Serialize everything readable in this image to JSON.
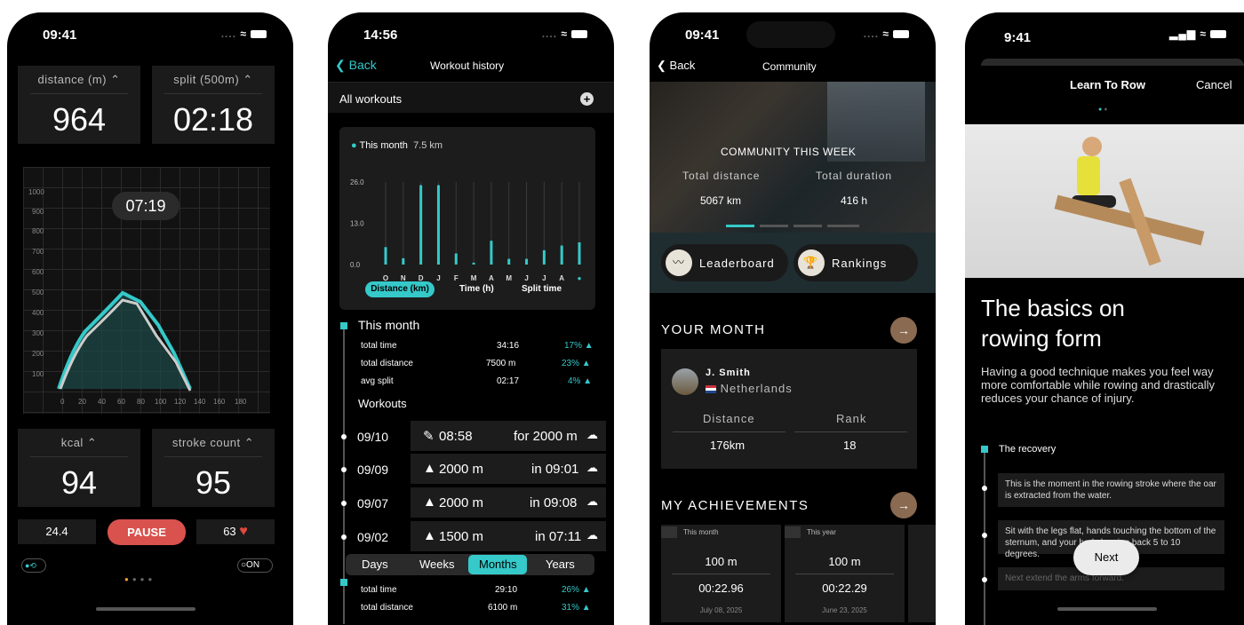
{
  "phone1": {
    "status_time": "09:41",
    "status_icons": "....",
    "tiles": [
      {
        "label": "distance (m) ⌃",
        "value": "964"
      },
      {
        "label": "split (500m) ⌃",
        "value": "02:18"
      },
      {
        "label": "kcal ⌃",
        "value": "94"
      },
      {
        "label": "stroke count ⌃",
        "value": "95"
      }
    ],
    "timer": "07:19",
    "y_ticks": [
      "1000",
      "900",
      "800",
      "700",
      "600",
      "500",
      "400",
      "300",
      "200",
      "100"
    ],
    "x_ticks": [
      "0",
      "20",
      "40",
      "60",
      "80",
      "100",
      "120",
      "140",
      "160",
      "180"
    ],
    "left_metric": "24.4",
    "pause_label": "PAUSE",
    "heart_value": "63",
    "toggle_label": "ON",
    "accent": "#35c9c9",
    "pause_color": "#d9524d",
    "heart_color": "#e0483f",
    "progress_fraction": 0.5
  },
  "phone2": {
    "status_time": "14:56",
    "status_icons": "....",
    "back_label": "Back",
    "title": "Workout history",
    "all_workouts": "All workouts",
    "legend": "This month",
    "legend_value": "7.5 km",
    "chart_data": {
      "type": "bar",
      "categories": [
        "O",
        "N",
        "D",
        "J",
        "F",
        "M",
        "A",
        "M",
        "J",
        "J",
        "A",
        "●"
      ],
      "series": [
        {
          "name": "",
          "values": [
            5.5,
            2,
            25,
            25,
            3.5,
            0.6,
            7.5,
            1.8,
            1.8,
            4.5,
            6,
            7
          ]
        }
      ],
      "y_ticks": [
        "26.0",
        "13.0",
        "0.0"
      ],
      "ylim": [
        0,
        26
      ],
      "grid": true
    },
    "metric_tabs": [
      "Distance (km)",
      "Time (h)",
      "Split time"
    ],
    "this_month": "This month",
    "stats": [
      {
        "label": "total time",
        "value": "34:16",
        "pct": "17%"
      },
      {
        "label": "total distance",
        "value": "7500 m",
        "pct": "23%"
      },
      {
        "label": "avg split",
        "value": "02:17",
        "pct": "4%"
      }
    ],
    "workouts_label": "Workouts",
    "workouts": [
      {
        "date": "09/10",
        "dist": "08:58",
        "result": "for 2000 m"
      },
      {
        "date": "09/09",
        "dist": "2000 m",
        "result": "in 09:01"
      },
      {
        "date": "09/07",
        "dist": "2000 m",
        "result": "in 09:08"
      },
      {
        "date": "09/02",
        "dist": "1500 m",
        "result": "in 07:11"
      }
    ],
    "period_tabs": [
      "Days",
      "Weeks",
      "Months",
      "Years"
    ],
    "bottom_stats": [
      {
        "label": "total time",
        "value": "29:10",
        "pct": "26%"
      },
      {
        "label": "total distance",
        "value": "6100 m",
        "pct": "31%"
      }
    ]
  },
  "phone3": {
    "status_time": "09:41",
    "status_icons": "....",
    "back_label": "Back",
    "title": "Community",
    "hero_title": "COMMUNITY THIS WEEK",
    "hero_labels": [
      "Total distance",
      "Total duration"
    ],
    "hero_values": [
      "5067 km",
      "416 h"
    ],
    "leaderboard": "Leaderboard",
    "rankings": "Rankings",
    "your_month": "YOUR MONTH",
    "user_name": "J. Smith",
    "user_country": "Netherlands",
    "col_labels": [
      "Distance",
      "Rank"
    ],
    "col_values": [
      "176km",
      "18"
    ],
    "achievements": "MY ACHIEVEMENTS",
    "ach_cards": [
      {
        "tag": "This month",
        "dist": "100 m",
        "time": "00:22.96",
        "date": "July 08, 2025"
      },
      {
        "tag": "This year",
        "dist": "100 m",
        "time": "00:22.29",
        "date": "June 23, 2025"
      }
    ]
  },
  "phone4": {
    "status_time": "9:41",
    "title": "Learn To Row",
    "cancel": "Cancel",
    "heading_line1": "The basics on",
    "heading_line2": "rowing form",
    "body": "Having a good technique makes you feel way more comfortable while rowing and drastically reduces your chance of injury.",
    "section": "The recovery",
    "steps": [
      "This is the moment in the rowing stroke where the oar is extracted from the water.",
      "Sit with the legs flat, hands touching the bottom of the sternum, and your body leaning back 5 to 10 degrees.",
      "Next extend the arms forward."
    ],
    "next": "Next"
  }
}
